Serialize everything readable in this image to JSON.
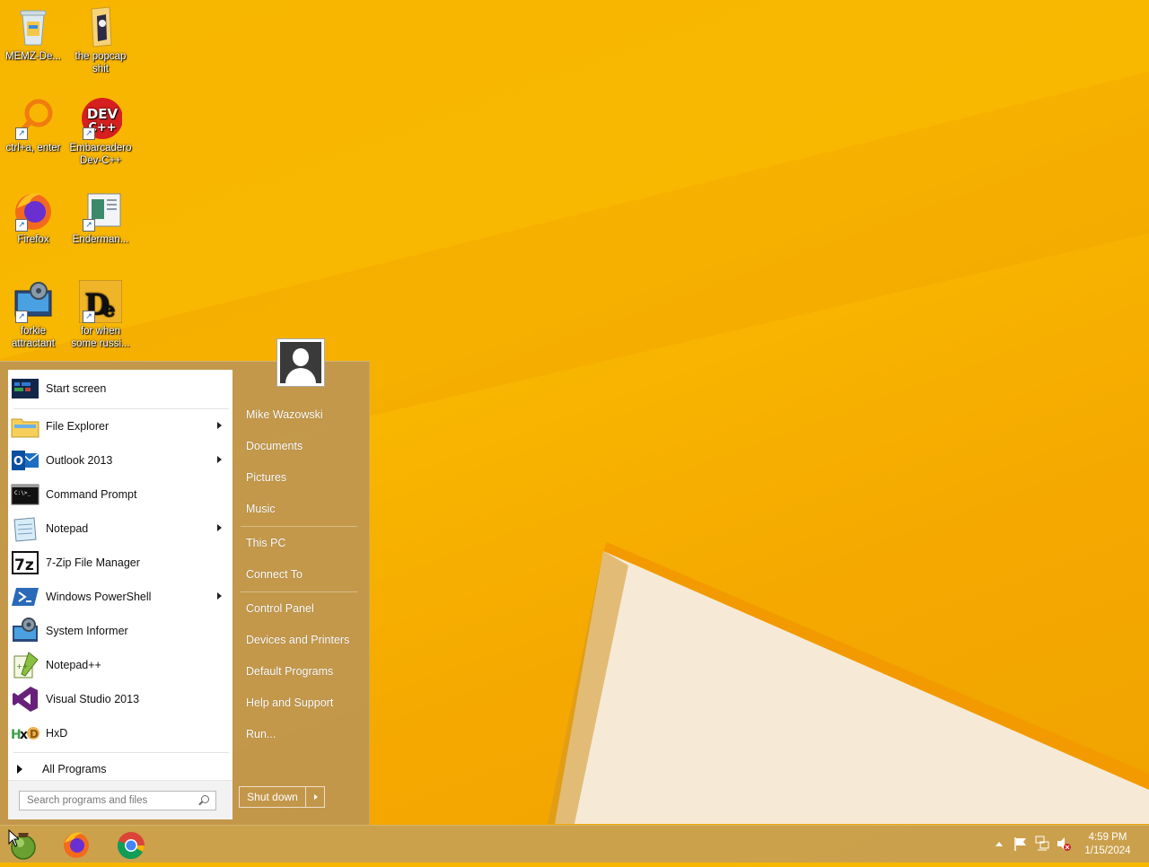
{
  "desktop": {
    "icons": [
      {
        "label": "MEMZ-De...",
        "icon": "recycle-bin-icon"
      },
      {
        "label": "the popcap shit",
        "icon": "folder-icon"
      },
      {
        "label": "ctrl+a, enter",
        "icon": "magnifier-icon"
      },
      {
        "label": "Embarcadero Dev-C++",
        "icon": "devcpp-icon"
      },
      {
        "label": "Firefox",
        "icon": "firefox-icon"
      },
      {
        "label": "Enderman...",
        "icon": "document-icon"
      },
      {
        "label": "forkie attractant",
        "icon": "system-informer-icon"
      },
      {
        "label": "for when some russi...",
        "icon": "de-app-icon"
      }
    ]
  },
  "start_menu": {
    "programs": [
      {
        "label": "Start screen",
        "icon": "start-screen-icon",
        "submenu": false
      },
      {
        "label": "File Explorer",
        "icon": "file-explorer-icon",
        "submenu": true
      },
      {
        "label": "Outlook 2013",
        "icon": "outlook-icon",
        "submenu": true
      },
      {
        "label": "Command Prompt",
        "icon": "command-prompt-icon",
        "submenu": false
      },
      {
        "label": "Notepad",
        "icon": "notepad-icon",
        "submenu": true
      },
      {
        "label": "7-Zip File Manager",
        "icon": "7zip-icon",
        "submenu": false
      },
      {
        "label": "Windows PowerShell",
        "icon": "powershell-icon",
        "submenu": true
      },
      {
        "label": "System Informer",
        "icon": "system-informer-icon",
        "submenu": false
      },
      {
        "label": "Notepad++",
        "icon": "notepadpp-icon",
        "submenu": false
      },
      {
        "label": "Visual Studio 2013",
        "icon": "visual-studio-icon",
        "submenu": false
      },
      {
        "label": "HxD",
        "icon": "hxd-icon",
        "submenu": false
      }
    ],
    "all_programs": "All Programs",
    "search_placeholder": "Search programs and files",
    "right_column": {
      "user_name": "Mike Wazowski",
      "links": [
        "Documents",
        "Pictures",
        "Music",
        "This PC",
        "Connect To",
        "Control Panel",
        "Devices and Printers",
        "Default Programs",
        "Help and Support",
        "Run..."
      ]
    },
    "shutdown_label": "Shut down"
  },
  "taskbar": {
    "pinned": [
      "start-orb-icon",
      "firefox-icon",
      "chrome-icon"
    ],
    "tray_icons": [
      "show-hidden-icons-icon",
      "action-center-flag-icon",
      "network-icon",
      "volume-muted-icon"
    ],
    "time": "4:59 PM",
    "date": "1/15/2024"
  },
  "colors": {
    "wallpaper": "#f7b500",
    "start_menu_glass": "#be9650",
    "taskbar": "#c8a050"
  }
}
